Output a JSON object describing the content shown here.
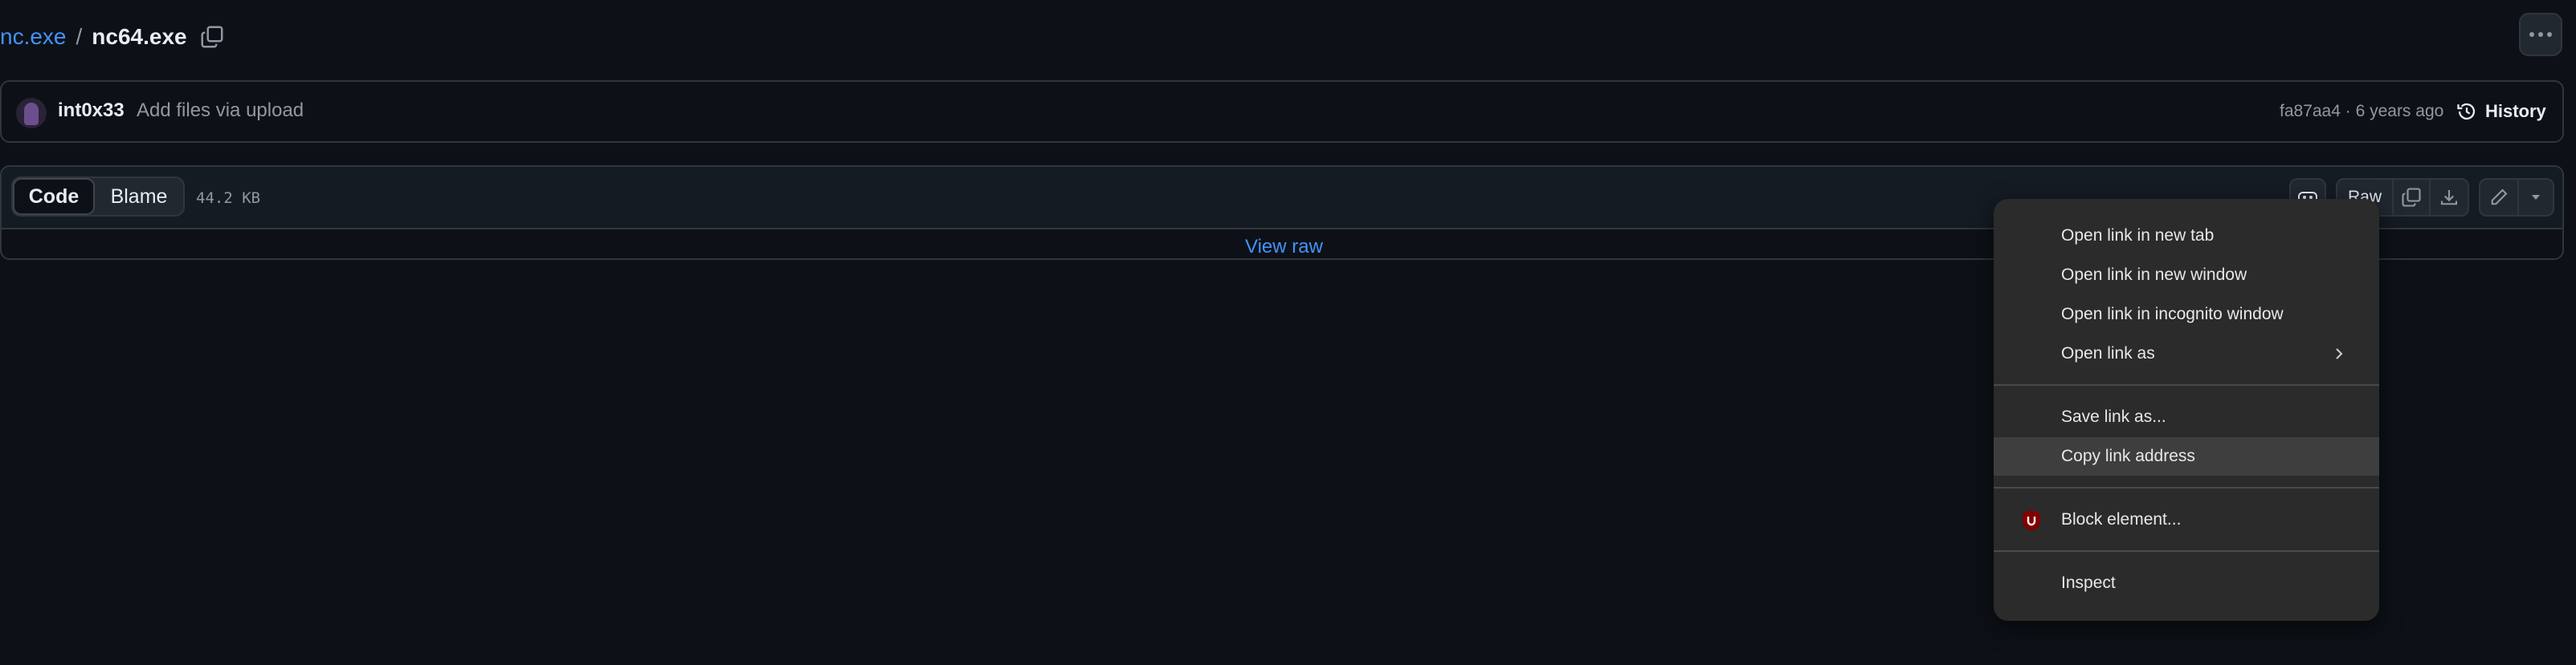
{
  "breadcrumb": {
    "parent": "nc.exe",
    "separator": "/",
    "current": "nc64.exe"
  },
  "commit": {
    "author": "int0x33",
    "message": "Add files via upload",
    "meta": "fa87aa4 · 6 years ago",
    "history_label": "History"
  },
  "file": {
    "code_tab": "Code",
    "blame_tab": "Blame",
    "size": "44.2 KB",
    "raw_label": "Raw",
    "view_raw": "View raw"
  },
  "context_menu": {
    "items": [
      "Open link in new tab",
      "Open link in new window",
      "Open link in incognito window",
      "Open link as",
      "Save link as...",
      "Copy link address",
      "Block element...",
      "Inspect"
    ],
    "highlighted": "Copy link address"
  },
  "colors": {
    "background": "#0d1117",
    "link": "#4493f8",
    "border": "#30363d",
    "menu_bg": "#2b2b2b",
    "ublock_red": "#800000"
  },
  "icons": [
    "copy-icon",
    "kebab-icon",
    "history-icon",
    "copilot-icon",
    "download-icon",
    "pencil-icon",
    "triangle-down-icon",
    "chevron-right-icon",
    "ublock-origin-icon"
  ]
}
